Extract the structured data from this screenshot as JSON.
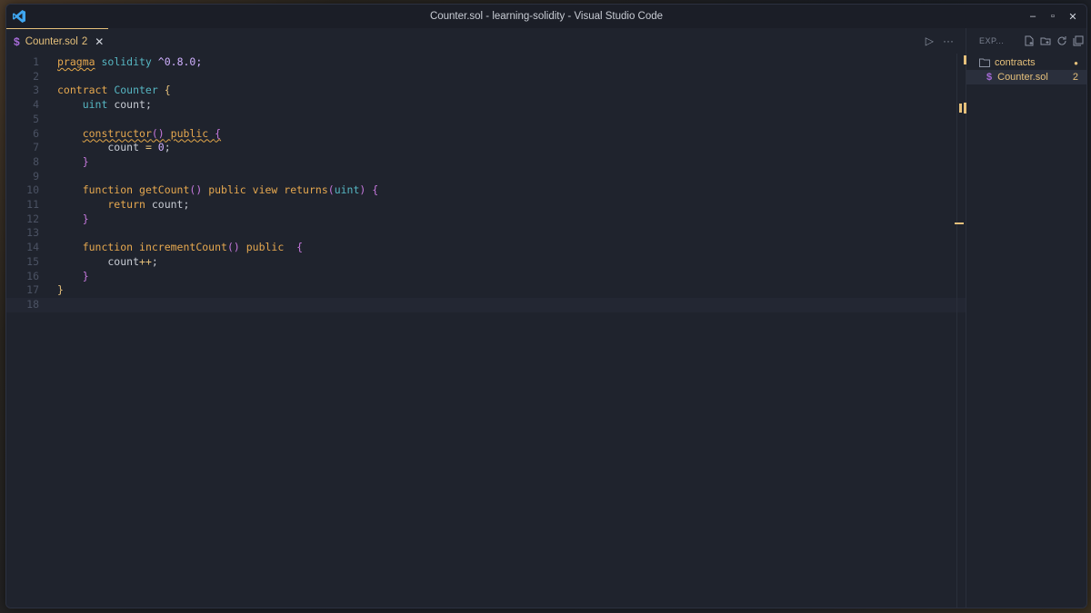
{
  "window": {
    "title": "Counter.sol - learning-solidity - Visual Studio Code"
  },
  "controls": {
    "minimize": "–",
    "maximize": "▫",
    "close": "✕"
  },
  "tab": {
    "icon": "$",
    "name": "Counter.sol",
    "problems": "2",
    "close": "✕"
  },
  "editor_actions": {
    "run": "▷",
    "more": "···"
  },
  "explorer": {
    "title": "EXP...",
    "actions": [
      "new-file-icon",
      "new-folder-icon",
      "refresh-icon",
      "collapse-icon"
    ],
    "folder": {
      "name": "contracts",
      "badge": "●"
    },
    "file": {
      "icon": "$",
      "name": "Counter.sol",
      "problems": "2"
    }
  },
  "line_numbers": [
    "1",
    "2",
    "3",
    "4",
    "5",
    "6",
    "7",
    "8",
    "9",
    "10",
    "11",
    "12",
    "13",
    "14",
    "15",
    "16",
    "17",
    "18"
  ],
  "code": {
    "l1_a": "pragma",
    "l1_b": " solidity ",
    "l1_c": "^0.8.0;",
    "l3_a": "contract ",
    "l3_b": "Counter ",
    "l3_c": "{",
    "l4_a": "    ",
    "l4_b": "uint",
    "l4_c": " count;",
    "l6_a": "    ",
    "l6_b": "constructor",
    "l6_c": "()",
    "l6_d": " public ",
    "l6_e": "{",
    "l7_a": "        count ",
    "l7_b": "=",
    "l7_c": " 0",
    "l7_d": ";",
    "l8_a": "    ",
    "l8_b": "}",
    "l10_a": "    function ",
    "l10_b": "getCount",
    "l10_c": "()",
    "l10_d": " public view returns",
    "l10_e": "(",
    "l10_f": "uint",
    "l10_g": ")",
    "l10_h": " {",
    "l11_a": "        return",
    "l11_b": " count;",
    "l12_a": "    ",
    "l12_b": "}",
    "l14_a": "    function ",
    "l14_b": "incrementCount",
    "l14_c": "()",
    "l14_d": " public  ",
    "l14_e": "{",
    "l15_a": "        count",
    "l15_b": "++",
    "l15_c": ";",
    "l16_a": "    ",
    "l16_b": "}",
    "l17_a": "}"
  }
}
